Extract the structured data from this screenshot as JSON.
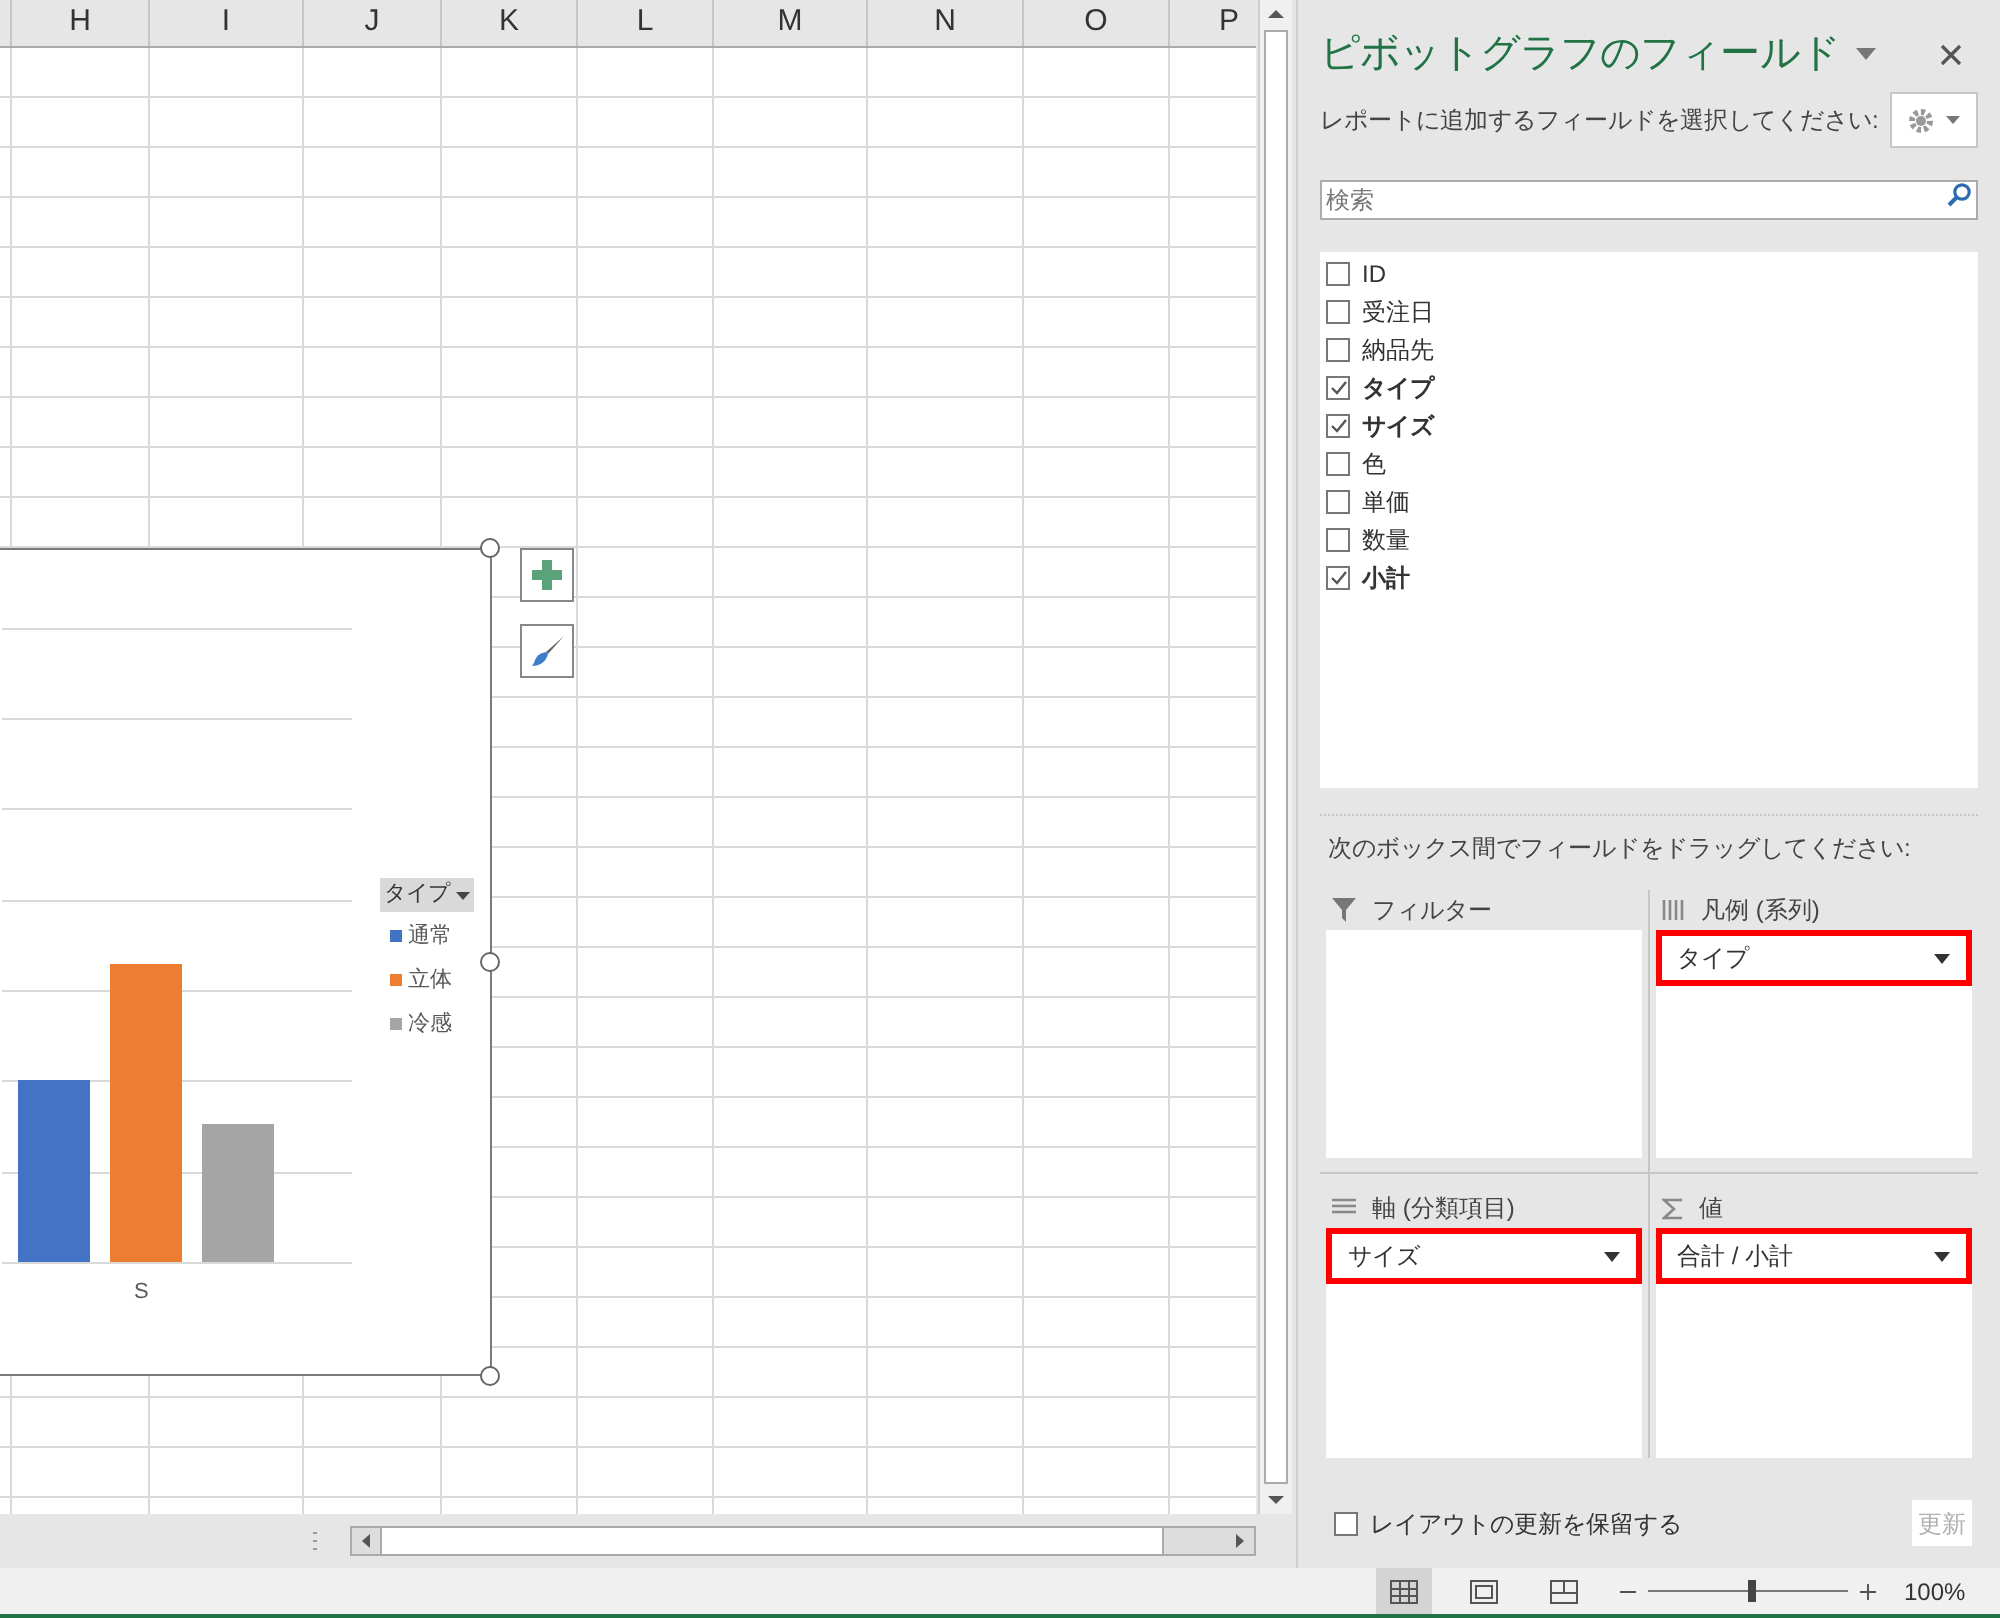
{
  "spreadsheet": {
    "columns": [
      "H",
      "I",
      "J",
      "K",
      "L",
      "M",
      "N",
      "O",
      "P"
    ]
  },
  "chart": {
    "category": "S",
    "legend": {
      "title": "タイプ",
      "items": [
        {
          "label": "通常",
          "color": "#4472c4"
        },
        {
          "label": "立体",
          "color": "#ed7d31"
        },
        {
          "label": "冷感",
          "color": "#a5a5a5"
        }
      ]
    }
  },
  "pane": {
    "title": "ピボットグラフのフィールド",
    "instruction": "レポートに追加するフィールドを選択してください:",
    "search": {
      "placeholder": "検索"
    },
    "fields": [
      {
        "label": "ID",
        "checked": false
      },
      {
        "label": "受注日",
        "checked": false
      },
      {
        "label": "納品先",
        "checked": false
      },
      {
        "label": "タイプ",
        "checked": true
      },
      {
        "label": "サイズ",
        "checked": true
      },
      {
        "label": "色",
        "checked": false
      },
      {
        "label": "単価",
        "checked": false
      },
      {
        "label": "数量",
        "checked": false
      },
      {
        "label": "小計",
        "checked": true
      }
    ],
    "areas_instruction": "次のボックス間でフィールドをドラッグしてください:",
    "areas": [
      {
        "kind": "filter",
        "label": "フィルター"
      },
      {
        "kind": "legend",
        "label": "凡例 (系列)",
        "items": [
          {
            "label": "タイプ",
            "highlighted": true
          }
        ]
      },
      {
        "kind": "axis",
        "label": "軸 (分類項目)",
        "items": [
          {
            "label": "サイズ",
            "highlighted": true
          }
        ]
      },
      {
        "kind": "values",
        "label": "値",
        "items": [
          {
            "label": "合計 / 小計",
            "highlighted": true
          }
        ]
      }
    ],
    "defer": {
      "label": "レイアウトの更新を保留する",
      "checked": false
    },
    "update_button": {
      "label": "更新",
      "disabled": true
    }
  },
  "status_bar": {
    "views": [
      {
        "kind": "normal",
        "selected": true
      },
      {
        "kind": "page-layout",
        "selected": false
      },
      {
        "kind": "page-break",
        "selected": false
      }
    ],
    "zoom": {
      "level": 0.52,
      "reading": "100%"
    }
  }
}
